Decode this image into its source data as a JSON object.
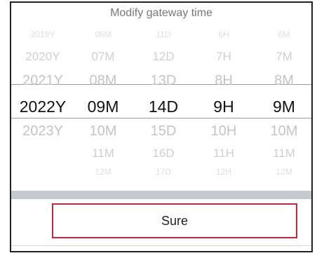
{
  "dialog": {
    "title": "Modify gateway time",
    "sure_label": "Sure"
  },
  "picker": {
    "columns": [
      {
        "name": "year",
        "rows": [
          "2019Y",
          "2020Y",
          "2021Y",
          "2022Y",
          "2023Y",
          "",
          ""
        ],
        "selected": "2022Y"
      },
      {
        "name": "month",
        "rows": [
          "06M",
          "07M",
          "08M",
          "09M",
          "10M",
          "11M",
          "12M"
        ],
        "selected": "09M"
      },
      {
        "name": "day",
        "rows": [
          "11D",
          "12D",
          "13D",
          "14D",
          "15D",
          "16D",
          "17D"
        ],
        "selected": "14D"
      },
      {
        "name": "hour",
        "rows": [
          "6H",
          "7H",
          "8H",
          "9H",
          "10H",
          "11H",
          "12H"
        ],
        "selected": "9H"
      },
      {
        "name": "minute",
        "rows": [
          "6M",
          "7M",
          "8M",
          "9M",
          "10M",
          "11M",
          "12M"
        ],
        "selected": "9M"
      }
    ],
    "selected_index": 3
  },
  "colors": {
    "selected_text": "#111111",
    "unselected_text": "#c4c4c4",
    "button_border": "#c8283a",
    "separator_band": "#c8c9cf"
  }
}
